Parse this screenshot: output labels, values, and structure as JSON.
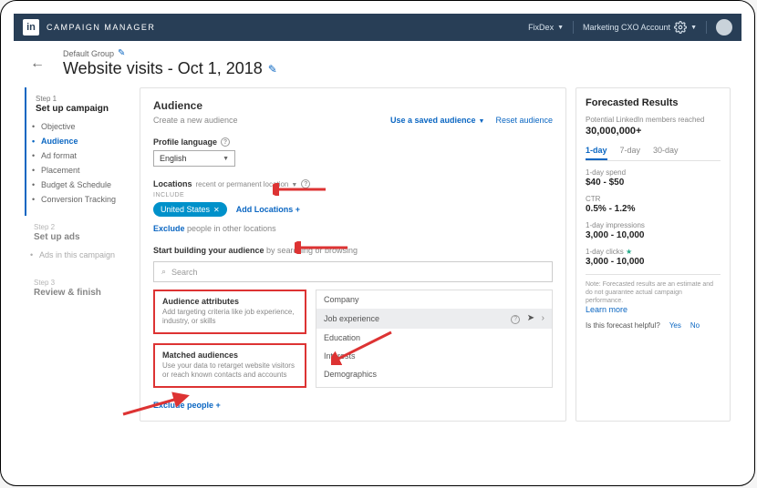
{
  "topbar": {
    "app_name": "CAMPAIGN MANAGER",
    "org": "FixDex",
    "account": "Marketing CXO Account"
  },
  "title": {
    "group": "Default Group",
    "name": "Website visits - Oct 1, 2018"
  },
  "sidebar": {
    "step1_label": "Step 1",
    "step1_title": "Set up campaign",
    "items": [
      "Objective",
      "Audience",
      "Ad format",
      "Placement",
      "Budget & Schedule",
      "Conversion Tracking"
    ],
    "current": 1,
    "step2_label": "Step 2",
    "step2_title": "Set up ads",
    "step2_note": "Ads in this campaign",
    "step3_label": "Step 3",
    "step3_title": "Review & finish"
  },
  "panel": {
    "title": "Audience",
    "subtitle": "Create a new audience",
    "use_saved": "Use a saved audience",
    "reset": "Reset audience",
    "profile_lang_label": "Profile language",
    "profile_lang_value": "English",
    "locations_label": "Locations",
    "locations_sub": "recent or permanent location",
    "include": "INCLUDE",
    "location_chip": "United States",
    "add_locations": "Add Locations",
    "exclude_text": " people in other locations",
    "exclude_link": "Exclude",
    "build_label": "Start building your audience",
    "build_sub": " by searching or browsing",
    "search_placeholder": "Search",
    "card1_title": "Audience attributes",
    "card1_desc": "Add targeting criteria like job experience, industry, or skills",
    "card2_title": "Matched audiences",
    "card2_desc": "Use your data to retarget website visitors or reach known contacts and accounts",
    "menu": [
      "Company",
      "Job experience",
      "Education",
      "Interests",
      "Demographics"
    ],
    "menu_active": 1,
    "exclude_people": "Exclude people"
  },
  "forecast": {
    "title": "Forecasted Results",
    "reach_label": "Potential LinkedIn members reached",
    "reach_value": "30,000,000+",
    "tabs": [
      "1-day",
      "7-day",
      "30-day"
    ],
    "tab_active": 0,
    "m1_label": "1-day spend",
    "m1_value": "$40 - $50",
    "m2_label": "CTR",
    "m2_value": "0.5% - 1.2%",
    "m3_label": "1-day impressions",
    "m3_value": "3,000 - 10,000",
    "m4_label": "1-day clicks",
    "m4_value": "3,000 - 10,000",
    "note": "Note: Forecasted results are an estimate and do not guarantee actual campaign performance.",
    "learn_more": "Learn more",
    "help_q": "Is this forecast helpful?",
    "yes": "Yes",
    "no": "No"
  }
}
